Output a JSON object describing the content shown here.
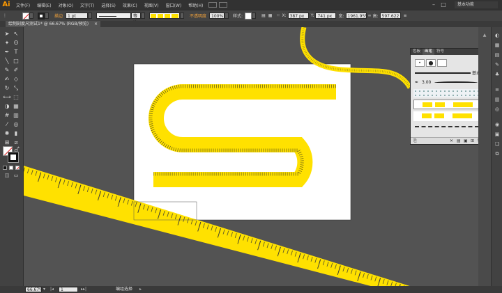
{
  "app": {
    "logo": "Ai",
    "workspace": "基本功能"
  },
  "menu": [
    "文件(F)",
    "编辑(E)",
    "对象(O)",
    "文字(T)",
    "选择(S)",
    "效果(C)",
    "视图(V)",
    "窗口(W)",
    "帮助(H)"
  ],
  "control": {
    "stroke_label": "描边",
    "stroke_weight": "1 pt",
    "stroke_style": "等比",
    "opacity_label": "不透明度",
    "opacity_value": "100%",
    "style_label": "样式:",
    "x_value": "387 px",
    "y_value": "741 px",
    "w_value": "1961.955",
    "h_value": "597.622"
  },
  "document": {
    "tab_title": "绘制刻度尺测试1* @ 66.67% (RGB/预览)"
  },
  "brush_panel": {
    "tabs": [
      "色板",
      "画笔",
      "符号"
    ],
    "basic_label": "基本",
    "size_label": "3.00"
  },
  "status": {
    "zoom": "66.67%",
    "page": "1",
    "tool_name": "编组选择"
  },
  "colors": {
    "ruler_yellow": "#ffe100",
    "canvas_gray": "#535353",
    "artboard": "#ffffff"
  },
  "icons": [
    "selection-tool-icon",
    "direct-selection-tool-icon",
    "pen-tool-icon",
    "type-tool-icon",
    "line-tool-icon",
    "rectangle-tool-icon",
    "brush-tool-icon",
    "pencil-tool-icon",
    "rotate-tool-icon",
    "scale-tool-icon",
    "hand-tool-icon",
    "zoom-tool-icon"
  ]
}
